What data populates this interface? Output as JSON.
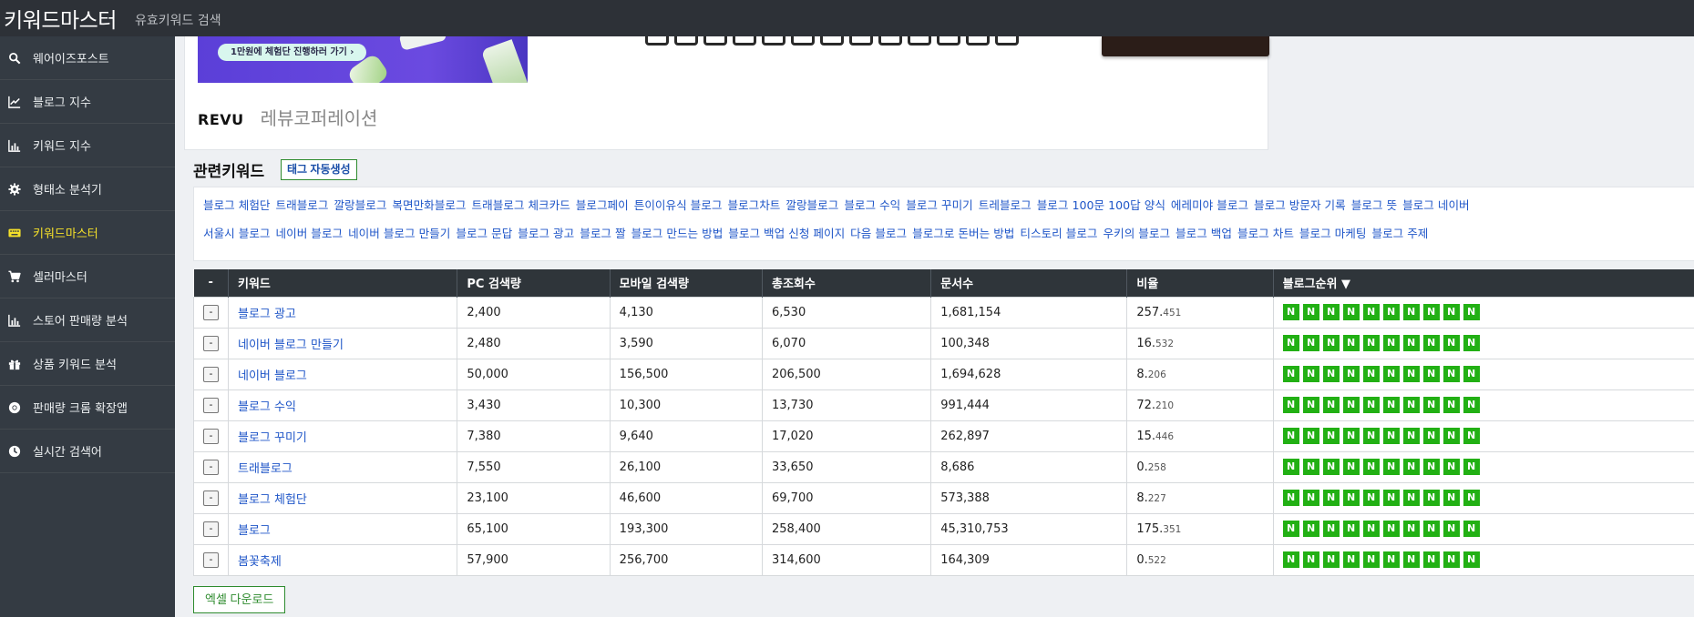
{
  "header": {
    "brand": "키워드마스터",
    "subtitle": "유효키워드 검색"
  },
  "sidebar": {
    "items": [
      {
        "label": "웨어이즈포스트",
        "icon": "search-icon"
      },
      {
        "label": "블로그 지수",
        "icon": "line-chart-icon"
      },
      {
        "label": "키워드 지수",
        "icon": "bar-chart-icon"
      },
      {
        "label": "형태소 분석기",
        "icon": "gear-icon"
      },
      {
        "label": "키워드마스터",
        "icon": "keyboard-icon",
        "active": true
      },
      {
        "label": "셀러마스터",
        "icon": "cart-icon"
      },
      {
        "label": "스토어 판매량 분석",
        "icon": "bar-chart-icon"
      },
      {
        "label": "상품 키워드 분석",
        "icon": "gift-icon"
      },
      {
        "label": "판매량 크롬 확장앱",
        "icon": "chrome-icon"
      },
      {
        "label": "실시간 검색어",
        "icon": "clock-icon"
      }
    ]
  },
  "ad": {
    "banner_cta": "1만원에 체험단 진행하러 가기",
    "logo": "REVU",
    "company": "레뷰코퍼레이션"
  },
  "related": {
    "title": "관련키워드",
    "tag_button": "태그 자동생성",
    "keywords_line1": [
      "블로그 체험단",
      "트래블로그",
      "깔랑블로그",
      "복면만화블로그",
      "트래블로그 체크카드",
      "블로그페이",
      "튼이이유식 블로그",
      "블로그차트",
      "깔랑블로그",
      "블로그 수익",
      "블로그 꾸미기",
      "트레블로그",
      "블로그 100문 100답 양식",
      "에레미야 블로그",
      "블로그 방문자 기록",
      "블로그 뜻",
      "블로그 네이버"
    ],
    "keywords_line2": [
      "서울시 블로그",
      "네이버 블로그",
      "네이버 블로그 만들기",
      "블로그 문답",
      "블로그 광고",
      "블로그 짤",
      "블로그 만드는 방법",
      "블로그 백업 신청 페이지",
      "다음 블로그",
      "블로그로 돈버는 방법",
      "티스토리 블로그",
      "우키의 블로그",
      "블로그 백업",
      "블로그 차트",
      "블로그 마케팅",
      "블로그 주제"
    ]
  },
  "table": {
    "columns": [
      "-",
      "키워드",
      "PC 검색량",
      "모바일 검색량",
      "총조회수",
      "문서수",
      "비율",
      "블로그순위 ▼"
    ],
    "remove_label": "-",
    "rank_label": "N",
    "rows": [
      {
        "keyword": "블로그 광고",
        "pc": "2,400",
        "mobile": "4,130",
        "total": "6,530",
        "docs": "1,681,154",
        "ratio_int": "257.",
        "ratio_dec": "451"
      },
      {
        "keyword": "네이버 블로그 만들기",
        "pc": "2,480",
        "mobile": "3,590",
        "total": "6,070",
        "docs": "100,348",
        "ratio_int": "16.",
        "ratio_dec": "532"
      },
      {
        "keyword": "네이버 블로그",
        "pc": "50,000",
        "mobile": "156,500",
        "total": "206,500",
        "docs": "1,694,628",
        "ratio_int": "8.",
        "ratio_dec": "206"
      },
      {
        "keyword": "블로그 수익",
        "pc": "3,430",
        "mobile": "10,300",
        "total": "13,730",
        "docs": "991,444",
        "ratio_int": "72.",
        "ratio_dec": "210"
      },
      {
        "keyword": "블로그 꾸미기",
        "pc": "7,380",
        "mobile": "9,640",
        "total": "17,020",
        "docs": "262,897",
        "ratio_int": "15.",
        "ratio_dec": "446"
      },
      {
        "keyword": "트래블로그",
        "pc": "7,550",
        "mobile": "26,100",
        "total": "33,650",
        "docs": "8,686",
        "ratio_int": "0.",
        "ratio_dec": "258"
      },
      {
        "keyword": "블로그 체험단",
        "pc": "23,100",
        "mobile": "46,600",
        "total": "69,700",
        "docs": "573,388",
        "ratio_int": "8.",
        "ratio_dec": "227"
      },
      {
        "keyword": "블로그",
        "pc": "65,100",
        "mobile": "193,300",
        "total": "258,400",
        "docs": "45,310,753",
        "ratio_int": "175.",
        "ratio_dec": "351"
      },
      {
        "keyword": "봄꽃축제",
        "pc": "57,900",
        "mobile": "256,700",
        "total": "314,600",
        "docs": "164,309",
        "ratio_int": "0.",
        "ratio_dec": "522"
      }
    ]
  },
  "excel_button": "엑셀 다운로드",
  "colors": {
    "topbar": "#2d3137",
    "sidebar": "#343b43",
    "active": "#f4e02a",
    "link": "#1f56c8",
    "rank_green": "#22b014"
  }
}
